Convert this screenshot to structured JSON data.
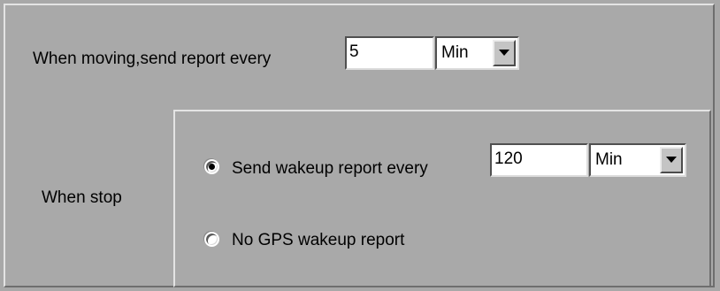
{
  "moving": {
    "label": "When moving,send report every",
    "interval_value": "5",
    "unit": "Min"
  },
  "stop": {
    "label": "When stop",
    "wakeup_option": {
      "label": "Send wakeup report every",
      "selected": true,
      "interval_value": "120",
      "unit": "Min"
    },
    "no_gps_option": {
      "label": "No GPS wakeup report",
      "selected": false
    }
  },
  "icons": {
    "dropdown": "chevron-down-icon"
  }
}
